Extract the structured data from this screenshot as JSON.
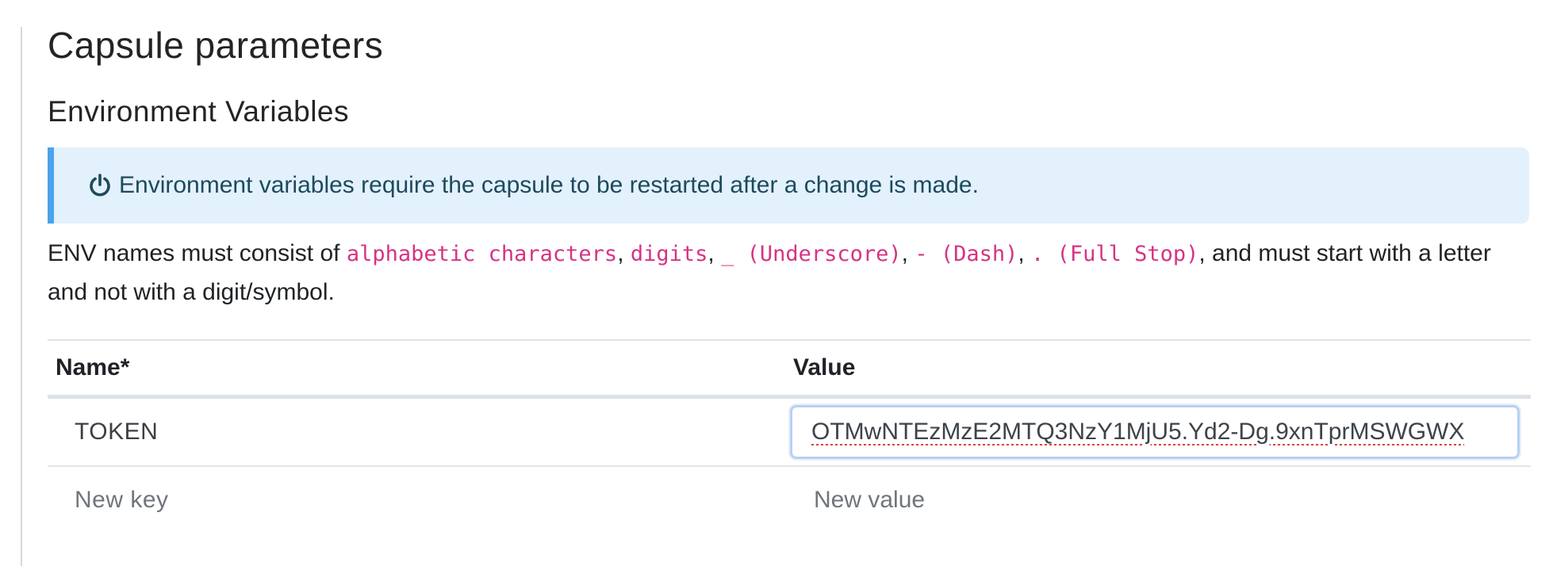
{
  "page": {
    "title": "Capsule parameters",
    "section_title": "Environment Variables"
  },
  "info": {
    "icon": "power-icon",
    "message": "Environment variables require the capsule to be restarted after a change is made.",
    "accent_color": "#4aa3ec",
    "background_color": "#e3f1fc"
  },
  "rules": {
    "prefix": "ENV names must consist of ",
    "token_alpha": "alphabetic characters",
    "token_digits": "digits",
    "token_underscore": "_ (Underscore)",
    "token_dash": "- (Dash)",
    "token_fullstop": ". (Full Stop)",
    "sep": ", ",
    "suffix": ", and must start with a letter and not with a digit/symbol."
  },
  "table": {
    "headers": {
      "name": "Name*",
      "value": "Value"
    },
    "rows": [
      {
        "name": "TOKEN",
        "value": "OTMwNTEzMzE2MTQ3NzY1MjU5.Yd2-Dg.9xnTprMSWGWX"
      }
    ],
    "new_row": {
      "key_placeholder": "New key",
      "value_placeholder": "New value"
    }
  }
}
